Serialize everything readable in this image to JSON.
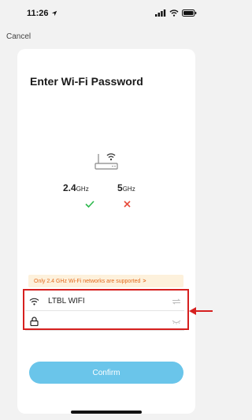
{
  "status_bar": {
    "time": "11:26",
    "icons": [
      "location-arrow-icon",
      "signal-icon",
      "wifi-icon",
      "battery-icon"
    ]
  },
  "nav": {
    "cancel_label": "Cancel"
  },
  "page": {
    "title": "Enter Wi-Fi Password"
  },
  "bands": {
    "band_24": {
      "value": "2.4",
      "unit": "GHz",
      "supported": true
    },
    "band_5": {
      "value": "5",
      "unit": "GHz",
      "supported": false
    }
  },
  "notice": {
    "text": "Only 2.4 GHz Wi-Fi networks are supported",
    "chevron": ">"
  },
  "form": {
    "ssid": {
      "value": "LTBL WIFI",
      "icon": "wifi-icon",
      "trailing_icon": "swap-icon"
    },
    "password": {
      "value": "",
      "placeholder": "",
      "icon": "lock-icon",
      "trailing_icon": "eye-closed-icon"
    }
  },
  "actions": {
    "confirm_label": "Confirm"
  },
  "colors": {
    "accent": "#6ac5ea",
    "success": "#2db84d",
    "error": "#e74c3c",
    "warning_text": "#e36a1c",
    "warning_bg": "#fdf1dc",
    "annotation": "#d6201f"
  }
}
